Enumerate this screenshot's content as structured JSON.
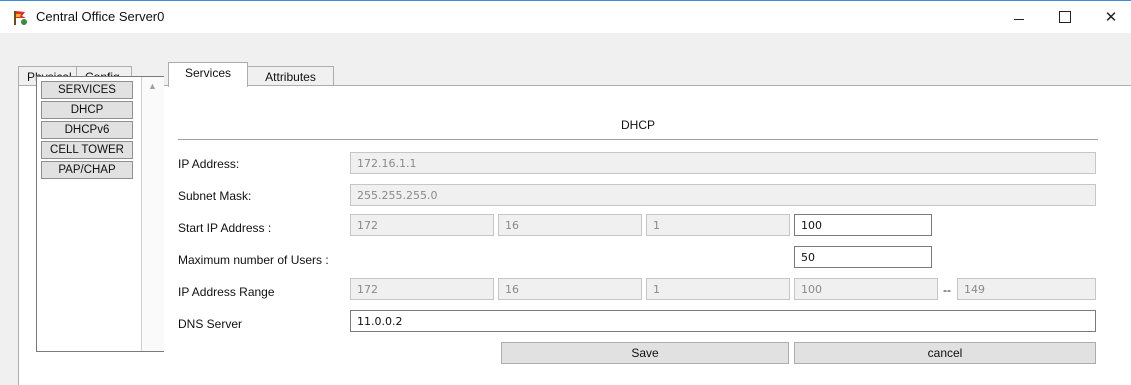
{
  "window": {
    "title": "Central Office Server0",
    "icon": "server-app-icon",
    "controls": {
      "minimize_icon": "minimize-icon",
      "maximize_icon": "maximize-icon",
      "close_label": "✕"
    }
  },
  "tabs": [
    {
      "label": "Physical",
      "active": false
    },
    {
      "label": "Config",
      "active": false
    },
    {
      "label": "Services",
      "active": true
    },
    {
      "label": "Attributes",
      "active": false
    }
  ],
  "services_list": {
    "items": [
      "SERVICES",
      "DHCP",
      "DHCPv6",
      "CELL TOWER",
      "PAP/CHAP"
    ]
  },
  "dhcp": {
    "header": "DHCP",
    "ip_address": {
      "label": "IP Address:",
      "value": "172.16.1.1"
    },
    "subnet_mask": {
      "label": "Subnet Mask:",
      "value": "255.255.255.0"
    },
    "start_ip": {
      "label": "Start IP Address :",
      "octets": [
        "172",
        "16",
        "1",
        "100"
      ]
    },
    "max_users": {
      "label": "Maximum number of Users :",
      "value": "50"
    },
    "ip_range": {
      "label": "IP Address Range",
      "octets": [
        "172",
        "16",
        "1",
        "100"
      ],
      "separator": "--",
      "end": "149"
    },
    "dns_server": {
      "label": "DNS Server",
      "value": "11.0.0.2"
    },
    "save_label": "Save",
    "cancel_label": "cancel"
  }
}
